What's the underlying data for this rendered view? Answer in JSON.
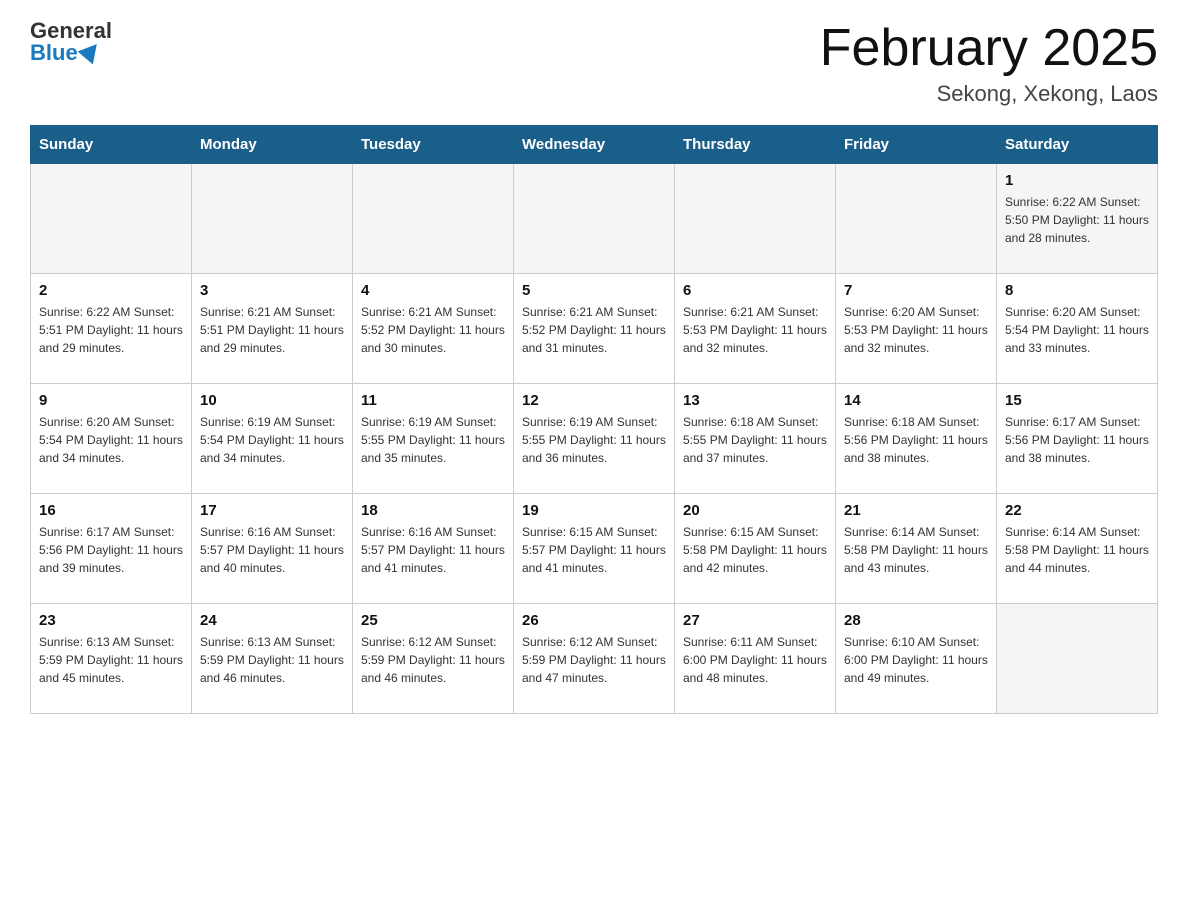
{
  "header": {
    "logo_general": "General",
    "logo_blue": "Blue",
    "title": "February 2025",
    "subtitle": "Sekong, Xekong, Laos"
  },
  "weekdays": [
    "Sunday",
    "Monday",
    "Tuesday",
    "Wednesday",
    "Thursday",
    "Friday",
    "Saturday"
  ],
  "weeks": [
    [
      {
        "day": "",
        "info": ""
      },
      {
        "day": "",
        "info": ""
      },
      {
        "day": "",
        "info": ""
      },
      {
        "day": "",
        "info": ""
      },
      {
        "day": "",
        "info": ""
      },
      {
        "day": "",
        "info": ""
      },
      {
        "day": "1",
        "info": "Sunrise: 6:22 AM\nSunset: 5:50 PM\nDaylight: 11 hours\nand 28 minutes."
      }
    ],
    [
      {
        "day": "2",
        "info": "Sunrise: 6:22 AM\nSunset: 5:51 PM\nDaylight: 11 hours\nand 29 minutes."
      },
      {
        "day": "3",
        "info": "Sunrise: 6:21 AM\nSunset: 5:51 PM\nDaylight: 11 hours\nand 29 minutes."
      },
      {
        "day": "4",
        "info": "Sunrise: 6:21 AM\nSunset: 5:52 PM\nDaylight: 11 hours\nand 30 minutes."
      },
      {
        "day": "5",
        "info": "Sunrise: 6:21 AM\nSunset: 5:52 PM\nDaylight: 11 hours\nand 31 minutes."
      },
      {
        "day": "6",
        "info": "Sunrise: 6:21 AM\nSunset: 5:53 PM\nDaylight: 11 hours\nand 32 minutes."
      },
      {
        "day": "7",
        "info": "Sunrise: 6:20 AM\nSunset: 5:53 PM\nDaylight: 11 hours\nand 32 minutes."
      },
      {
        "day": "8",
        "info": "Sunrise: 6:20 AM\nSunset: 5:54 PM\nDaylight: 11 hours\nand 33 minutes."
      }
    ],
    [
      {
        "day": "9",
        "info": "Sunrise: 6:20 AM\nSunset: 5:54 PM\nDaylight: 11 hours\nand 34 minutes."
      },
      {
        "day": "10",
        "info": "Sunrise: 6:19 AM\nSunset: 5:54 PM\nDaylight: 11 hours\nand 34 minutes."
      },
      {
        "day": "11",
        "info": "Sunrise: 6:19 AM\nSunset: 5:55 PM\nDaylight: 11 hours\nand 35 minutes."
      },
      {
        "day": "12",
        "info": "Sunrise: 6:19 AM\nSunset: 5:55 PM\nDaylight: 11 hours\nand 36 minutes."
      },
      {
        "day": "13",
        "info": "Sunrise: 6:18 AM\nSunset: 5:55 PM\nDaylight: 11 hours\nand 37 minutes."
      },
      {
        "day": "14",
        "info": "Sunrise: 6:18 AM\nSunset: 5:56 PM\nDaylight: 11 hours\nand 38 minutes."
      },
      {
        "day": "15",
        "info": "Sunrise: 6:17 AM\nSunset: 5:56 PM\nDaylight: 11 hours\nand 38 minutes."
      }
    ],
    [
      {
        "day": "16",
        "info": "Sunrise: 6:17 AM\nSunset: 5:56 PM\nDaylight: 11 hours\nand 39 minutes."
      },
      {
        "day": "17",
        "info": "Sunrise: 6:16 AM\nSunset: 5:57 PM\nDaylight: 11 hours\nand 40 minutes."
      },
      {
        "day": "18",
        "info": "Sunrise: 6:16 AM\nSunset: 5:57 PM\nDaylight: 11 hours\nand 41 minutes."
      },
      {
        "day": "19",
        "info": "Sunrise: 6:15 AM\nSunset: 5:57 PM\nDaylight: 11 hours\nand 41 minutes."
      },
      {
        "day": "20",
        "info": "Sunrise: 6:15 AM\nSunset: 5:58 PM\nDaylight: 11 hours\nand 42 minutes."
      },
      {
        "day": "21",
        "info": "Sunrise: 6:14 AM\nSunset: 5:58 PM\nDaylight: 11 hours\nand 43 minutes."
      },
      {
        "day": "22",
        "info": "Sunrise: 6:14 AM\nSunset: 5:58 PM\nDaylight: 11 hours\nand 44 minutes."
      }
    ],
    [
      {
        "day": "23",
        "info": "Sunrise: 6:13 AM\nSunset: 5:59 PM\nDaylight: 11 hours\nand 45 minutes."
      },
      {
        "day": "24",
        "info": "Sunrise: 6:13 AM\nSunset: 5:59 PM\nDaylight: 11 hours\nand 46 minutes."
      },
      {
        "day": "25",
        "info": "Sunrise: 6:12 AM\nSunset: 5:59 PM\nDaylight: 11 hours\nand 46 minutes."
      },
      {
        "day": "26",
        "info": "Sunrise: 6:12 AM\nSunset: 5:59 PM\nDaylight: 11 hours\nand 47 minutes."
      },
      {
        "day": "27",
        "info": "Sunrise: 6:11 AM\nSunset: 6:00 PM\nDaylight: 11 hours\nand 48 minutes."
      },
      {
        "day": "28",
        "info": "Sunrise: 6:10 AM\nSunset: 6:00 PM\nDaylight: 11 hours\nand 49 minutes."
      },
      {
        "day": "",
        "info": ""
      }
    ]
  ]
}
